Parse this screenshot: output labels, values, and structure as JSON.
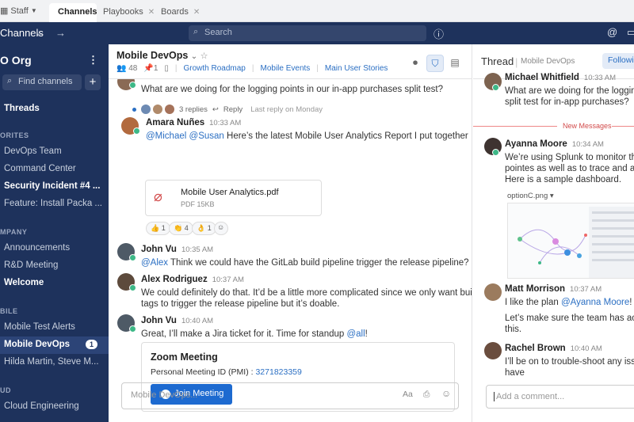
{
  "tabs": {
    "staff": "Staff",
    "items": [
      {
        "label": "Channels"
      },
      {
        "label": "Playbooks"
      },
      {
        "label": "Boards"
      }
    ]
  },
  "header": {
    "title": "Channels",
    "search_placeholder": "Search"
  },
  "sidebar": {
    "team": "O Org",
    "find_channels": "Find channels",
    "threads": "Threads",
    "sections": [
      {
        "label": "ORITES"
      },
      {
        "label": "MPANY"
      },
      {
        "label": "BILE"
      },
      {
        "label": "UD"
      }
    ],
    "items": [
      {
        "label": "DevOps Team"
      },
      {
        "label": "Command Center"
      },
      {
        "label": "Security Incident #4 ..."
      },
      {
        "label": "Feature: Install Packa ..."
      },
      {
        "label": "Announcements"
      },
      {
        "label": "R&D Meeting"
      },
      {
        "label": "Welcome"
      },
      {
        "label": "Mobile Test Alerts"
      },
      {
        "label": "Mobile DevOps"
      },
      {
        "label": "Hilda Martin, Steve M..."
      },
      {
        "label": "Cloud Engineering"
      }
    ],
    "mobile_devops_badge": "1"
  },
  "channel": {
    "name": "Mobile DevOps",
    "members": "48",
    "pinned": "1",
    "links": [
      "Growth Roadmap",
      "Mobile Events",
      "Main User Stories"
    ]
  },
  "messages": {
    "first": {
      "text": "What are we doing for the logging points in our in-app purchases split test?",
      "replies": "3 replies",
      "reply": "Reply",
      "last_reply": "Last reply on Monday"
    },
    "amara": {
      "author": "Amara Nuñes",
      "time": "10:33 AM",
      "mention1": "@Michael",
      "mention2": "@Susan",
      "text": " Here’s the latest Mobile User Analytics Report I put together",
      "file_name": "Mobile User Analytics.pdf",
      "file_size": "PDF 15KB",
      "reactions": [
        "👍 1",
        "👏 4",
        "👌 1"
      ]
    },
    "john1": {
      "author": "John Vu",
      "time": "10:35 AM",
      "mention": "@Alex",
      "text": " Think we could have the GitLab build pipeline trigger the release pipeline?"
    },
    "alex": {
      "author": "Alex Rodriguez",
      "time": "10:37 AM",
      "line1": "We could definitely do that. It’d be a little more complicated since we only want builds for",
      "line2": "tags to trigger the release pipeline but it’s doable."
    },
    "john2": {
      "author": "John Vu",
      "time": "10:40 AM",
      "text": "Great, I’ll make a Jira ticket for it. Time for standup ",
      "mention": "@all",
      "suffix": "!"
    },
    "zoom": {
      "title": "Zoom Meeting",
      "pmi_label": "Personal Meeting ID (PMI) : ",
      "pmi": "3271823359",
      "button": "Join Meeting"
    },
    "composer_placeholder": "Mobile DevOps...",
    "composer_format": "Aa"
  },
  "thread": {
    "title": "Thread",
    "channel": "Mobile DevOps",
    "following": "Following",
    "top_author": "Michael Whitfield",
    "top_time": "10:33 AM",
    "top_line1": "What are we doing for the logging",
    "top_line2": "split test for in-app purchases?",
    "new_messages": "New Messages",
    "ayanna": {
      "author": "Ayanna Moore",
      "time": "10:34 AM",
      "line1": "We’re using Splunk to monitor the lo",
      "line2": "pointes as well as to trace and analy",
      "line3": "Here is a sample dashboard.",
      "file": "optionC.png"
    },
    "matt": {
      "author": "Matt Morrison",
      "time": "10:37 AM",
      "line1a": "I like the plan ",
      "mention": "@Ayanna Moore",
      "line1b": "!",
      "line2": "Let’s make sure the team has access",
      "line3": "this."
    },
    "rachel": {
      "author": "Rachel Brown",
      "time": "10:40 AM",
      "line1": "I’ll be on to trouble-shoot any issues",
      "line2": "have"
    },
    "composer_placeholder": "Add a comment..."
  },
  "colors": {
    "sidebar": "#1e325c",
    "accent": "#1d6ad0",
    "link": "#2b6fc3",
    "online": "#3db887",
    "new_messages": "#d24b4b"
  }
}
